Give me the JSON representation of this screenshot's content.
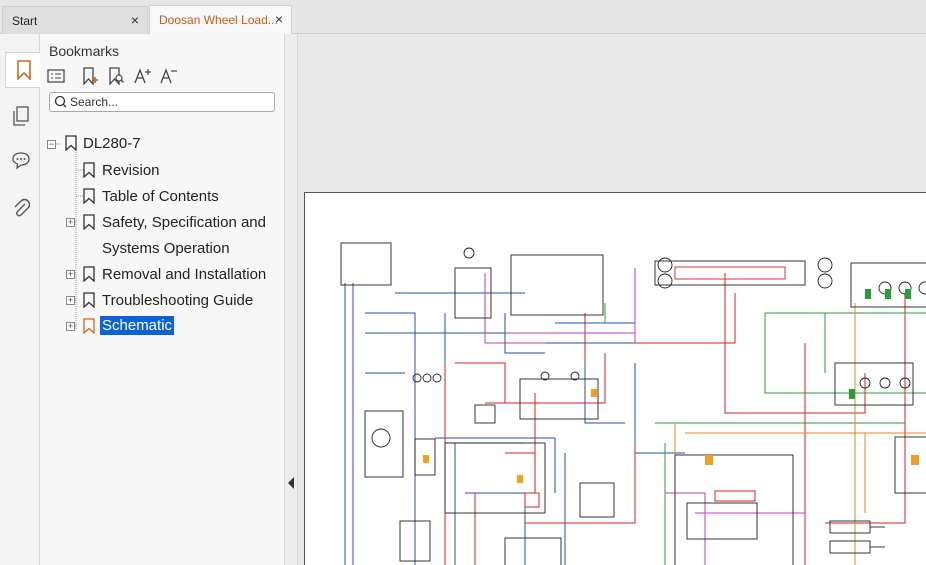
{
  "tabs": [
    {
      "label": "Start",
      "active": false
    },
    {
      "label": "Doosan Wheel Load...",
      "active": true
    }
  ],
  "close_glyph": "×",
  "rail": {
    "items": [
      {
        "name": "bookmark-panel-icon",
        "active": true
      },
      {
        "name": "pages-panel-icon",
        "active": false
      },
      {
        "name": "comments-panel-icon",
        "active": false
      },
      {
        "name": "attachments-panel-icon",
        "active": false
      }
    ]
  },
  "panel": {
    "title": "Bookmarks",
    "search_placeholder": "Search..."
  },
  "bookmarks": {
    "root": "DL280-7",
    "items": [
      {
        "label": "Revision",
        "expandable": false
      },
      {
        "label": "Table of Contents",
        "expandable": false
      },
      {
        "label_line1": "Safety, Specification and",
        "label_line2": "Systems Operation",
        "expandable": true
      },
      {
        "label": "Removal and Installation",
        "expandable": true
      },
      {
        "label": "Troubleshooting Guide",
        "expandable": true
      },
      {
        "label": "Schematic",
        "expandable": true,
        "selected": true
      }
    ]
  },
  "colors": {
    "accent": "#c65b17",
    "selection": "#0a64d6"
  }
}
